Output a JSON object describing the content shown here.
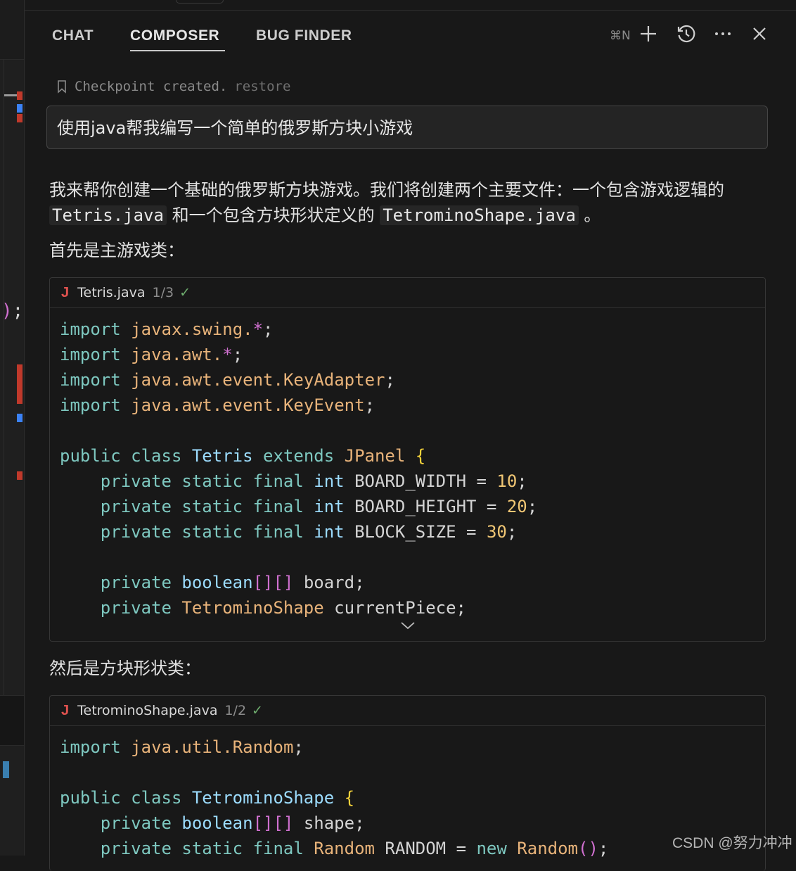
{
  "header": {
    "tabs": [
      {
        "label": "CHAT",
        "active": false
      },
      {
        "label": "COMPOSER",
        "active": true
      },
      {
        "label": "BUG FINDER",
        "active": false
      }
    ],
    "shortcut_hint": "⌘N",
    "icons": [
      "plus-icon",
      "history-icon",
      "more-icon",
      "close-icon"
    ]
  },
  "checkpoint": {
    "text": "Checkpoint created.",
    "restore_label": "restore"
  },
  "user_prompt": "使用java帮我编写一个简单的俄罗斯方块小游戏",
  "response": {
    "intro_part1": "我来帮你创建一个基础的俄罗斯方块游戏。我们将创建两个主要文件：一个包含游戏逻辑的",
    "file1_inline": "Tetris.java",
    "intro_part2": "和一个包含方块形状定义的",
    "file2_inline": "TetrominoShape.java",
    "intro_part3": "。",
    "main_class_heading": "首先是主游戏类：",
    "shape_class_heading": "然后是方块形状类："
  },
  "code_blocks": [
    {
      "filename": "Tetris.java",
      "version": "1/3",
      "lines": [
        "import javax.swing.*;",
        "import java.awt.*;",
        "import java.awt.event.KeyAdapter;",
        "import java.awt.event.KeyEvent;",
        "",
        "public class Tetris extends JPanel {",
        "    private static final int BOARD_WIDTH = 10;",
        "    private static final int BOARD_HEIGHT = 20;",
        "    private static final int BLOCK_SIZE = 30;",
        "",
        "    private boolean[][] board;",
        "    private TetrominoShape currentPiece;"
      ]
    },
    {
      "filename": "TetrominoShape.java",
      "version": "1/2",
      "lines": [
        "import java.util.Random;",
        "",
        "public class TetrominoShape {",
        "    private boolean[][] shape;",
        "    private static final Random RANDOM = new Random();"
      ]
    }
  ],
  "watermark": "CSDN @努力冲冲",
  "colors": {
    "background": "#181818",
    "keyword": "#7ec8c0",
    "type": "#9cdcfe",
    "package": "#e8b37a",
    "number": "#f0c674",
    "java_icon": "#e0524f"
  }
}
